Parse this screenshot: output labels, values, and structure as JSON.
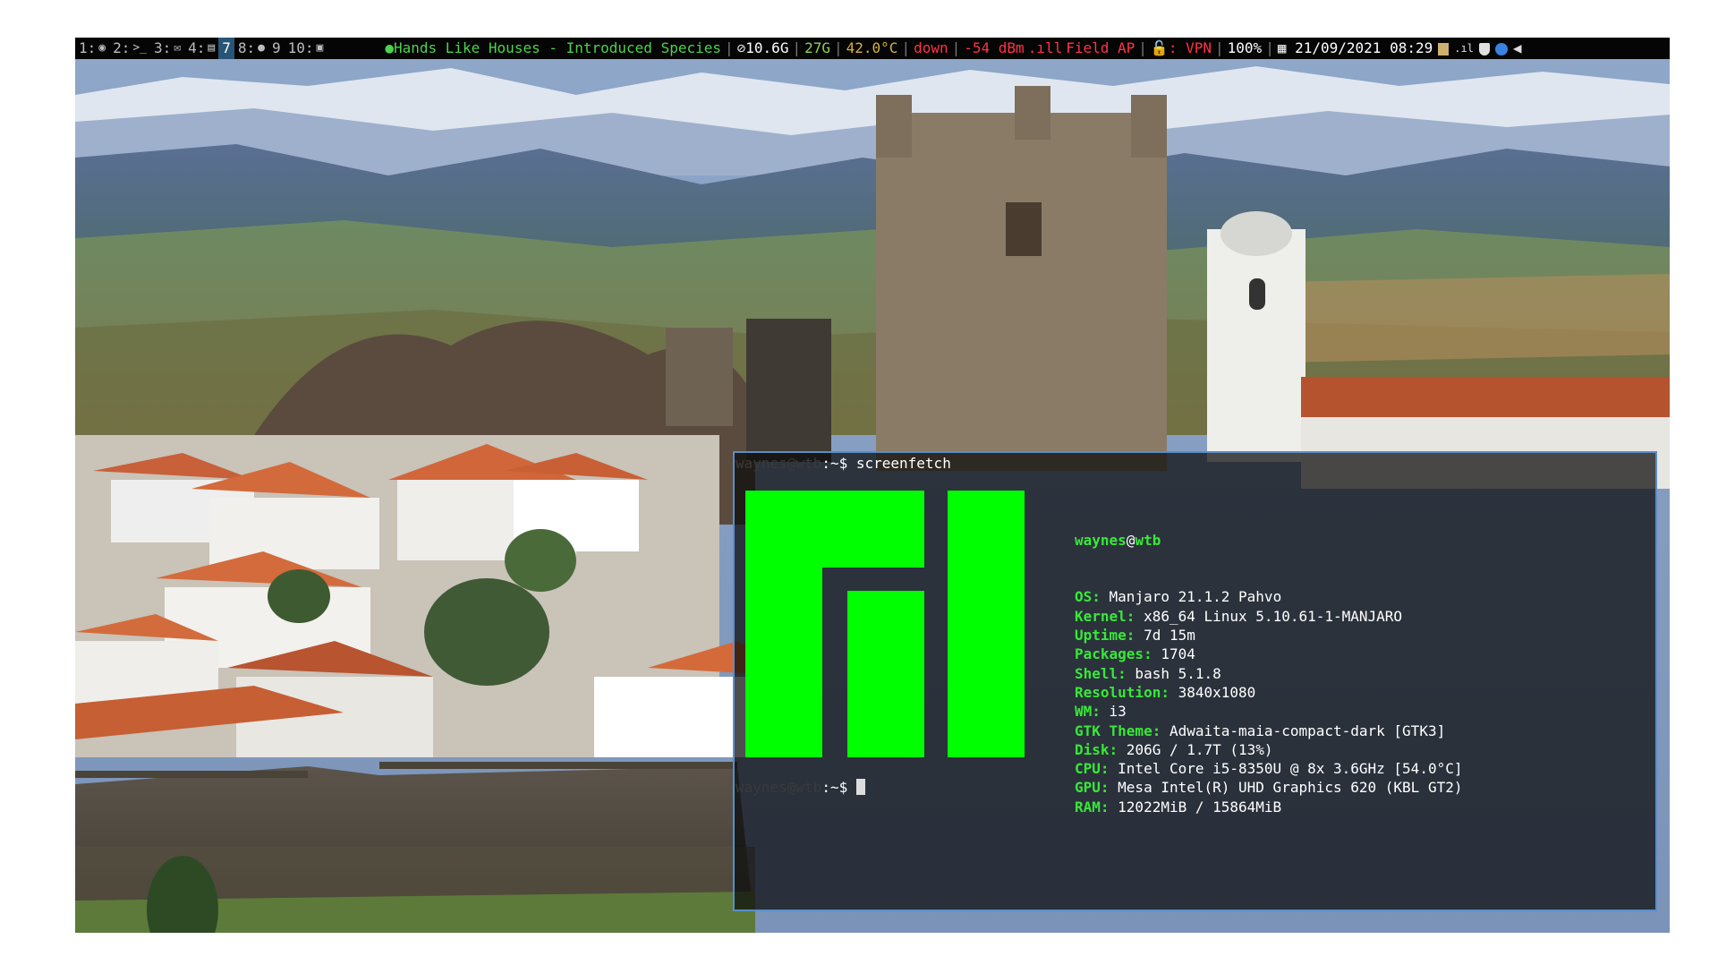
{
  "statusbar": {
    "workspaces": [
      {
        "label": "1:",
        "icon": "github-icon",
        "glyph": "◉",
        "active": false
      },
      {
        "label": "2:",
        "icon": "terminal-icon",
        "glyph": ">_",
        "active": false
      },
      {
        "label": "3:",
        "icon": "mail-icon",
        "glyph": "✉",
        "active": false
      },
      {
        "label": "4:",
        "icon": "document-icon",
        "glyph": "▤",
        "active": false
      },
      {
        "label": "7",
        "icon": "",
        "glyph": "",
        "active": true
      },
      {
        "label": "8:",
        "icon": "spotify-icon",
        "glyph": "●",
        "active": false
      },
      {
        "label": "9",
        "icon": "",
        "glyph": "",
        "active": false
      },
      {
        "label": "10:",
        "icon": "window-icon",
        "glyph": "▣",
        "active": false
      }
    ],
    "now_playing": "Hands Like Houses - Introduced Species",
    "memory": "10.6G",
    "disk": "27G",
    "temperature": "42.0°C",
    "net_state": "down",
    "signal": "-54 dBm",
    "essid": "Field AP",
    "vpn": ": VPN",
    "battery": "100%",
    "datetime": "21/09/2021  08:29"
  },
  "terminal": {
    "user": "waynes@wtb",
    "prompt_suffix": ":~$ ",
    "command": "screenfetch",
    "logo_color": "#00ff00",
    "info": {
      "user_name": "waynes",
      "at": "@",
      "host": "wtb",
      "rows": [
        {
          "label": "OS:",
          "value": " Manjaro 21.1.2 Pahvo"
        },
        {
          "label": "Kernel:",
          "value": " x86_64 Linux 5.10.61-1-MANJARO"
        },
        {
          "label": "Uptime:",
          "value": " 7d 15m"
        },
        {
          "label": "Packages:",
          "value": " 1704"
        },
        {
          "label": "Shell:",
          "value": " bash 5.1.8"
        },
        {
          "label": "Resolution:",
          "value": " 3840x1080"
        },
        {
          "label": "WM:",
          "value": " i3"
        },
        {
          "label": "GTK Theme:",
          "value": " Adwaita-maia-compact-dark [GTK3]"
        },
        {
          "label": "Disk:",
          "value": " 206G / 1.7T (13%)"
        },
        {
          "label": "CPU:",
          "value": " Intel Core i5-8350U @ 8x 3.6GHz [54.0°C]"
        },
        {
          "label": "GPU:",
          "value": " Mesa Intel(R) UHD Graphics 620 (KBL GT2)"
        },
        {
          "label": "RAM:",
          "value": " 12022MiB / 15864MiB"
        }
      ]
    }
  }
}
